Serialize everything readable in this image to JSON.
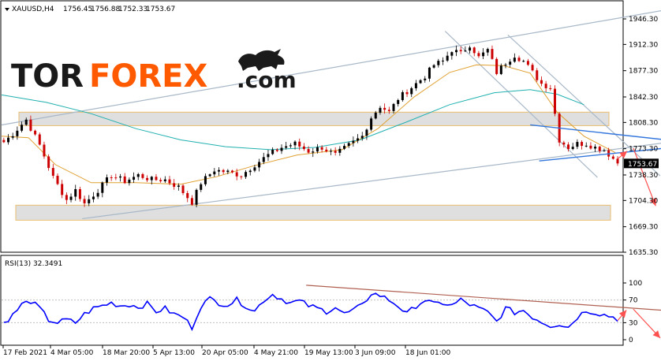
{
  "header": {
    "symbol": "XAUUSD,H4",
    "open": "1756.45",
    "high": "1756.88",
    "low": "1752.33",
    "close": "1753.67"
  },
  "logo": {
    "part1": "TOR",
    "part2": "FOREX",
    "part3": ".com"
  },
  "colors": {
    "bull": "#000000",
    "bear": "#cc0000",
    "ma_fast": "#e0a030",
    "ma_slow": "#20b0b0",
    "rsi": "#0000ff",
    "trend": "#a8b8c8",
    "zone_fill": "#dcdcdc",
    "zone_border": "#e8b860",
    "arrow": "#ff5050",
    "rsi_trend": "#b06050"
  },
  "chart_data": [
    {
      "type": "candlestick",
      "title": "XAUUSD,H4",
      "ylim": [
        1635.3,
        1963.0
      ],
      "y_ticks": [
        "1946.30",
        "1912.30",
        "1877.30",
        "1842.30",
        "1808.30",
        "1773.30",
        "1738.30",
        "1704.30",
        "1669.30",
        "1635.30"
      ],
      "current_price": "1753.67",
      "x_ticks": [
        "17 Feb 2021",
        "4 Mar 05:00",
        "18 Mar 20:00",
        "5 Apr 13:00",
        "20 Apr 05:00",
        "4 May 21:00",
        "19 May 13:00",
        "3 Jun 09:00",
        "18 Jun 01:00"
      ],
      "close_path": [
        [
          0,
          1782
        ],
        [
          2,
          1793
        ],
        [
          5,
          1812
        ],
        [
          8,
          1778
        ],
        [
          11,
          1735
        ],
        [
          14,
          1705
        ],
        [
          16,
          1718
        ],
        [
          18,
          1700
        ],
        [
          21,
          1718
        ],
        [
          24,
          1738
        ],
        [
          27,
          1730
        ],
        [
          30,
          1738
        ],
        [
          33,
          1732
        ],
        [
          36,
          1732
        ],
        [
          39,
          1722
        ],
        [
          42,
          1702
        ],
        [
          44,
          1728
        ],
        [
          47,
          1745
        ],
        [
          50,
          1742
        ],
        [
          53,
          1738
        ],
        [
          56,
          1752
        ],
        [
          59,
          1765
        ],
        [
          62,
          1775
        ],
        [
          65,
          1780
        ],
        [
          68,
          1770
        ],
        [
          71,
          1775
        ],
        [
          74,
          1765
        ],
        [
          77,
          1778
        ],
        [
          80,
          1790
        ],
        [
          82,
          1815
        ],
        [
          84,
          1830
        ],
        [
          86,
          1822
        ],
        [
          88,
          1840
        ],
        [
          90,
          1850
        ],
        [
          92,
          1860
        ],
        [
          94,
          1870
        ],
        [
          96,
          1885
        ],
        [
          98,
          1890
        ],
        [
          100,
          1905
        ],
        [
          102,
          1900
        ],
        [
          104,
          1912
        ],
        [
          106,
          1895
        ],
        [
          108,
          1905
        ],
        [
          110,
          1875
        ],
        [
          112,
          1888
        ],
        [
          114,
          1898
        ],
        [
          116,
          1890
        ],
        [
          118,
          1875
        ],
        [
          120,
          1860
        ],
        [
          122,
          1855
        ],
        [
          124,
          1785
        ],
        [
          126,
          1775
        ],
        [
          128,
          1780
        ],
        [
          130,
          1780
        ],
        [
          132,
          1775
        ],
        [
          134,
          1772
        ],
        [
          136,
          1760
        ],
        [
          137,
          1753.67
        ]
      ],
      "ma_fast_path": [
        [
          0,
          1790
        ],
        [
          6,
          1788
        ],
        [
          12,
          1752
        ],
        [
          20,
          1728
        ],
        [
          30,
          1728
        ],
        [
          40,
          1726
        ],
        [
          48,
          1736
        ],
        [
          56,
          1750
        ],
        [
          66,
          1765
        ],
        [
          76,
          1772
        ],
        [
          84,
          1800
        ],
        [
          92,
          1842
        ],
        [
          100,
          1875
        ],
        [
          106,
          1885
        ],
        [
          112,
          1884
        ],
        [
          118,
          1874
        ],
        [
          124,
          1822
        ],
        [
          130,
          1790
        ],
        [
          137,
          1768
        ]
      ],
      "ma_slow_path": [
        [
          0,
          1845
        ],
        [
          10,
          1835
        ],
        [
          20,
          1820
        ],
        [
          30,
          1800
        ],
        [
          40,
          1785
        ],
        [
          50,
          1776
        ],
        [
          60,
          1772
        ],
        [
          70,
          1775
        ],
        [
          80,
          1785
        ],
        [
          90,
          1808
        ],
        [
          100,
          1832
        ],
        [
          110,
          1848
        ],
        [
          118,
          1852
        ],
        [
          124,
          1846
        ],
        [
          130,
          1832
        ]
      ],
      "trendlines": [
        [
          [
            0,
            1805
          ],
          [
            148,
            1958
          ]
        ],
        [
          [
            18,
            1680
          ],
          [
            185,
            1810
          ]
        ],
        [
          [
            99,
            1930
          ],
          [
            133,
            1735
          ]
        ],
        [
          [
            113,
            1925
          ],
          [
            147,
            1737
          ]
        ]
      ],
      "blue_lines": [
        [
          [
            118,
            1805
          ],
          [
            153,
            1782
          ]
        ],
        [
          [
            120,
            1757
          ],
          [
            153,
            1777
          ]
        ]
      ],
      "zones": [
        {
          "x": [
            6,
            190
          ],
          "y": [
            1804,
            1822
          ]
        },
        {
          "x": [
            6,
            190
          ],
          "y": [
            1678,
            1698
          ]
        }
      ],
      "arrows": [
        [
          [
            141,
            1774
          ],
          [
            146,
            1697
          ]
        ]
      ]
    },
    {
      "type": "line",
      "title": "RSI(13) 32.3491",
      "ylim": [
        0,
        100
      ],
      "y_ticks": [
        100,
        70,
        30,
        0
      ],
      "levels": [
        70,
        30
      ],
      "path": [
        [
          0,
          30
        ],
        [
          2,
          43
        ],
        [
          4,
          62
        ],
        [
          6,
          68
        ],
        [
          8,
          55
        ],
        [
          10,
          35
        ],
        [
          12,
          30
        ],
        [
          14,
          35
        ],
        [
          16,
          30
        ],
        [
          18,
          45
        ],
        [
          20,
          55
        ],
        [
          22,
          60
        ],
        [
          24,
          65
        ],
        [
          26,
          60
        ],
        [
          28,
          62
        ],
        [
          30,
          58
        ],
        [
          32,
          63
        ],
        [
          34,
          50
        ],
        [
          36,
          55
        ],
        [
          38,
          45
        ],
        [
          40,
          40
        ],
        [
          42,
          22
        ],
        [
          44,
          60
        ],
        [
          46,
          72
        ],
        [
          48,
          65
        ],
        [
          50,
          62
        ],
        [
          52,
          70
        ],
        [
          54,
          60
        ],
        [
          56,
          50
        ],
        [
          58,
          70
        ],
        [
          60,
          80
        ],
        [
          62,
          72
        ],
        [
          64,
          65
        ],
        [
          66,
          68
        ],
        [
          68,
          60
        ],
        [
          70,
          55
        ],
        [
          72,
          50
        ],
        [
          74,
          58
        ],
        [
          76,
          45
        ],
        [
          78,
          52
        ],
        [
          80,
          60
        ],
        [
          82,
          82
        ],
        [
          84,
          78
        ],
        [
          86,
          70
        ],
        [
          88,
          60
        ],
        [
          90,
          45
        ],
        [
          92,
          60
        ],
        [
          94,
          70
        ],
        [
          96,
          62
        ],
        [
          98,
          65
        ],
        [
          100,
          60
        ],
        [
          102,
          70
        ],
        [
          104,
          62
        ],
        [
          106,
          55
        ],
        [
          108,
          48
        ],
        [
          110,
          32
        ],
        [
          112,
          55
        ],
        [
          114,
          48
        ],
        [
          116,
          52
        ],
        [
          118,
          40
        ],
        [
          120,
          32
        ],
        [
          122,
          25
        ],
        [
          124,
          28
        ],
        [
          126,
          22
        ],
        [
          128,
          40
        ],
        [
          130,
          52
        ],
        [
          132,
          48
        ],
        [
          134,
          44
        ],
        [
          136,
          40
        ],
        [
          137,
          32.35
        ]
      ],
      "trendline": [
        [
          68,
          96
        ],
        [
          160,
          45
        ]
      ],
      "arrow": [
        [
          141,
          54
        ],
        [
          147,
          3
        ]
      ]
    }
  ]
}
